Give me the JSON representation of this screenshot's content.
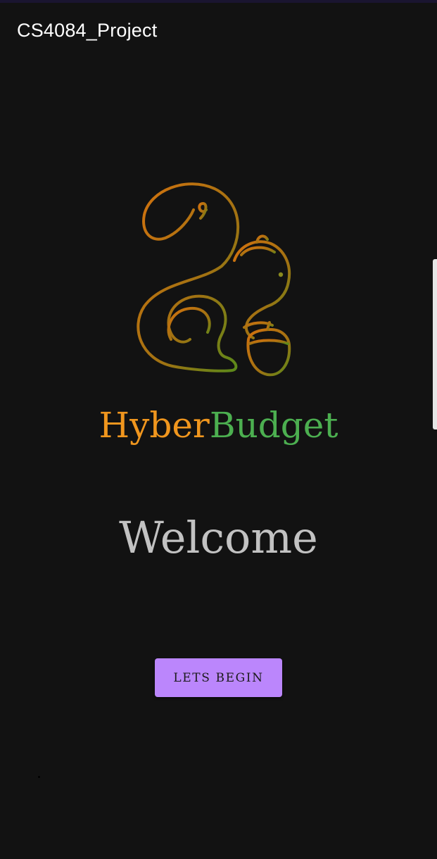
{
  "app_bar": {
    "title": "CS4084_Project"
  },
  "logo": {
    "icon": "squirrel-icon",
    "gradient_colors": [
      "#d2720e",
      "#8a8a1e",
      "#5a8a1a"
    ]
  },
  "brand": {
    "part1": "Hyber",
    "part2": "Budget",
    "part1_color": "#f0961e",
    "part2_color": "#4caf50"
  },
  "welcome_text": "Welcome",
  "begin_button": {
    "label": "LETS BEGIN",
    "color": "#bb86fc"
  },
  "theme": {
    "background": "#121212",
    "welcome_color": "#c2c2c2"
  }
}
